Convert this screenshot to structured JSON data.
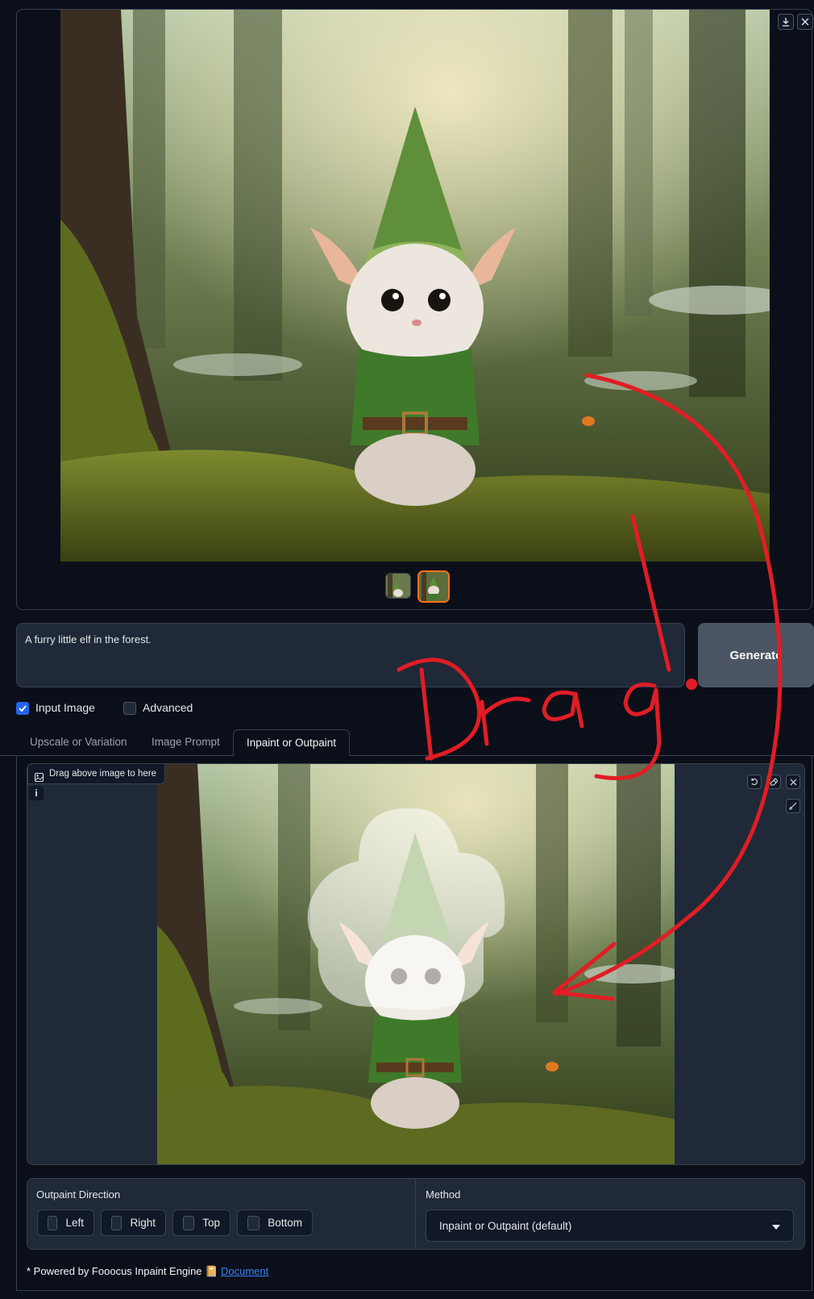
{
  "gallery": {
    "download_icon": "download-icon",
    "close_icon": "close-icon",
    "thumbnail_count": 2,
    "selected_thumbnail": 2
  },
  "prompt": {
    "text": "A furry little elf in the forest."
  },
  "generate": {
    "label": "Generate"
  },
  "options": {
    "input_image": {
      "label": "Input Image",
      "checked": true
    },
    "advanced": {
      "label": "Advanced",
      "checked": false
    }
  },
  "tabs": [
    {
      "label": "Upscale or Variation",
      "active": false
    },
    {
      "label": "Image Prompt",
      "active": false
    },
    {
      "label": "Inpaint or Outpaint",
      "active": true
    }
  ],
  "editor": {
    "drag_label": "Drag above image to here",
    "info_badge": "i",
    "tools": [
      "undo-icon",
      "eraser-icon",
      "close-icon",
      "brush-icon"
    ]
  },
  "outpaint": {
    "title": "Outpaint Direction",
    "directions": [
      {
        "label": "Left",
        "checked": false
      },
      {
        "label": "Right",
        "checked": false
      },
      {
        "label": "Top",
        "checked": false
      },
      {
        "label": "Bottom",
        "checked": false
      }
    ]
  },
  "method": {
    "title": "Method",
    "selected": "Inpaint or Outpaint (default)"
  },
  "footer": {
    "text": "* Powered by Fooocus Inpaint Engine",
    "doc_emoji": "📔",
    "link": "Document"
  },
  "annotation": {
    "text": "Drag!"
  },
  "colors": {
    "background": "#0b0f19",
    "panel": "#1f2937",
    "accent_orange": "#f97316",
    "checkbox_blue": "#2563eb",
    "annotation_red": "#e11d25"
  }
}
